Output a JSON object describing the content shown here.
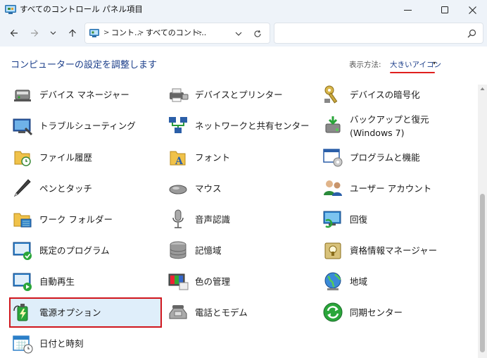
{
  "window": {
    "title": "すべてのコントロール パネル項目"
  },
  "address": {
    "crumbs": [
      "コント...",
      "すべてのコント..."
    ],
    "search_placeholder": ""
  },
  "header": {
    "title": "コンピューターの設定を調整します",
    "view_by_label": "表示方法:",
    "view_by_value": "大きいアイコン"
  },
  "items": [
    {
      "label": "デバイス マネージャー",
      "icon": "device-manager-icon"
    },
    {
      "label": "デバイスとプリンター",
      "icon": "printer-icon"
    },
    {
      "label": "デバイスの暗号化",
      "icon": "key-icon"
    },
    {
      "label": "トラブルシューティング",
      "icon": "troubleshoot-icon"
    },
    {
      "label": "ネットワークと共有センター",
      "icon": "network-icon"
    },
    {
      "label": "バックアップと復元\n(Windows 7)",
      "icon": "backup-icon"
    },
    {
      "label": "ファイル履歴",
      "icon": "file-history-icon"
    },
    {
      "label": "フォント",
      "icon": "fonts-icon"
    },
    {
      "label": "プログラムと機能",
      "icon": "programs-icon"
    },
    {
      "label": "ペンとタッチ",
      "icon": "pen-icon"
    },
    {
      "label": "マウス",
      "icon": "mouse-icon"
    },
    {
      "label": "ユーザー アカウント",
      "icon": "users-icon"
    },
    {
      "label": "ワーク フォルダー",
      "icon": "work-folder-icon"
    },
    {
      "label": "音声認識",
      "icon": "microphone-icon"
    },
    {
      "label": "回復",
      "icon": "recovery-icon"
    },
    {
      "label": "既定のプログラム",
      "icon": "default-programs-icon"
    },
    {
      "label": "記憶域",
      "icon": "storage-icon"
    },
    {
      "label": "資格情報マネージャー",
      "icon": "credential-icon"
    },
    {
      "label": "自動再生",
      "icon": "autoplay-icon"
    },
    {
      "label": "色の管理",
      "icon": "color-icon"
    },
    {
      "label": "地域",
      "icon": "globe-icon"
    },
    {
      "label": "電源オプション",
      "icon": "power-icon"
    },
    {
      "label": "電話とモデム",
      "icon": "phone-icon"
    },
    {
      "label": "同期センター",
      "icon": "sync-icon"
    },
    {
      "label": "日付と時刻",
      "icon": "calendar-icon"
    }
  ],
  "colors": {
    "accent_link": "#1b3e8a",
    "highlight_border": "#d0161d",
    "underline": "#e0201e"
  }
}
